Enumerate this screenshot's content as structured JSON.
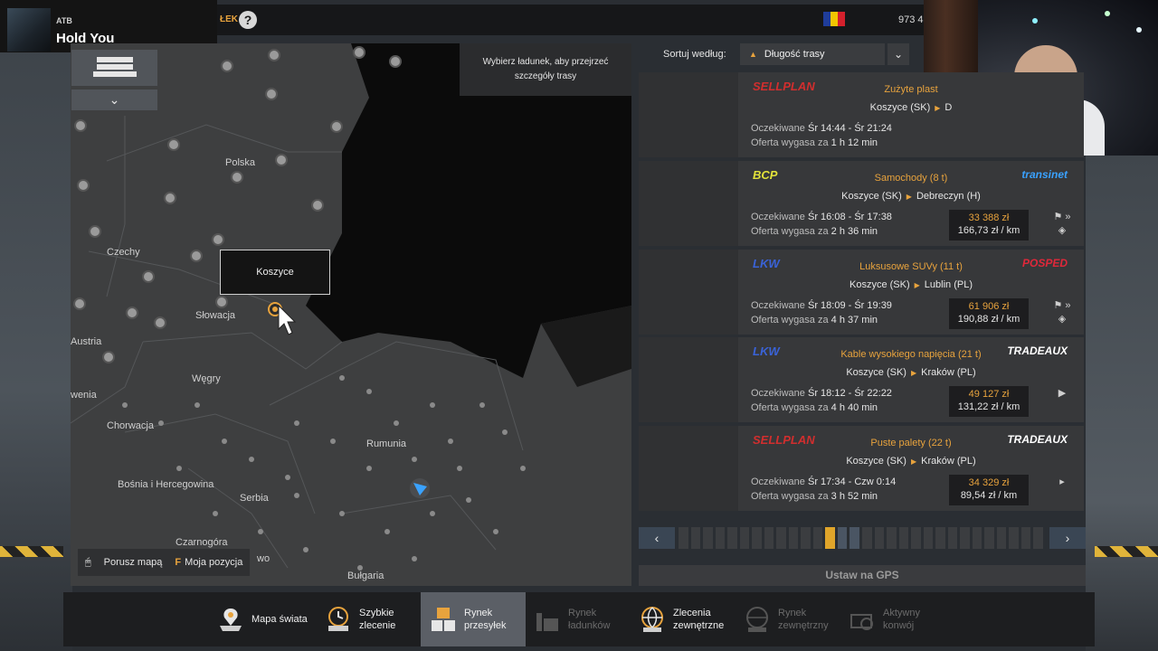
{
  "music": {
    "artist": "ATB",
    "title": "Hold You"
  },
  "header": {
    "title_fragment": "ŁEK",
    "help": "?",
    "money": "973 4"
  },
  "map": {
    "labels": [
      "Polska",
      "Czechy",
      "Słowacja",
      "Austria",
      "Węgry",
      "wenia",
      "Chorwacja",
      "Rumunia",
      "Bośnia i Hercegowina",
      "Serbia",
      "Czarnogóra",
      "wo",
      "Bułgaria"
    ],
    "tooltip": "Koszyce",
    "footer": {
      "move": "Porusz mapą",
      "key": "F",
      "position": "Moja pozycja"
    }
  },
  "hint": {
    "line1": "Wybierz ładunek, aby przejrzeć",
    "line2": "szczegóły trasy"
  },
  "sort": {
    "label": "Sortuj według:",
    "value": "Długość trasy"
  },
  "cards": [
    {
      "company": "SELLPLAN",
      "cargo": "Zużyte plast",
      "from": "Koszyce (SK)",
      "to": "D",
      "expected": "Oczekiwane",
      "window": "Śr 14:44 - Śr 21:24",
      "expire_label": "Oferta wygasa za",
      "expire": "1 h 12 min",
      "receiver": "",
      "price": "",
      "rate": ""
    },
    {
      "company": "BCP",
      "cargo": "Samochody (8 t)",
      "from": "Koszyce (SK)",
      "to": "Debreczyn (H)",
      "expected": "Oczekiwane",
      "window": "Śr 16:08 - Śr 17:38",
      "expire_label": "Oferta wygasa za",
      "expire": "2 h 36 min",
      "receiver": "transinet",
      "price": "33 388 zł",
      "rate": "166,73 zł / km"
    },
    {
      "company": "LKW",
      "cargo": "Luksusowe SUVy (11 t)",
      "from": "Koszyce (SK)",
      "to": "Lublin (PL)",
      "expected": "Oczekiwane",
      "window": "Śr 18:09 - Śr 19:39",
      "expire_label": "Oferta wygasa za",
      "expire": "4 h 37 min",
      "receiver": "POSPED",
      "price": "61 906 zł",
      "rate": "190,88 zł / km"
    },
    {
      "company": "LKW",
      "cargo": "Kable wysokiego napięcia (21 t)",
      "from": "Koszyce (SK)",
      "to": "Kraków (PL)",
      "expected": "Oczekiwane",
      "window": "Śr 18:12 - Śr 22:22",
      "expire_label": "Oferta wygasa za",
      "expire": "4 h 40 min",
      "receiver": "TRADEAUX",
      "price": "49 127 zł",
      "rate": "131,22 zł / km"
    },
    {
      "company": "SELLPLAN",
      "cargo": "Puste palety (22 t)",
      "from": "Koszyce (SK)",
      "to": "Kraków (PL)",
      "expected": "Oczekiwane",
      "window": "Śr 17:34 - Czw 0:14",
      "expire_label": "Oferta wygasa za",
      "expire": "3 h 52 min",
      "receiver": "TRADEAUX",
      "price": "34 329 zł",
      "rate": "89,54 zł / km"
    }
  ],
  "pager": {
    "prev": "‹",
    "next": "›",
    "pages": 30,
    "current": 12
  },
  "gps_button": "Ustaw na GPS",
  "tabs": [
    {
      "line1": "Mapa świata",
      "line2": ""
    },
    {
      "line1": "Szybkie",
      "line2": "zlecenie"
    },
    {
      "line1": "Rynek",
      "line2": "przesyłek"
    },
    {
      "line1": "Rynek",
      "line2": "ładunków"
    },
    {
      "line1": "Zlecenia",
      "line2": "zewnętrzne"
    },
    {
      "line1": "Rynek",
      "line2": "zewnętrzny"
    },
    {
      "line1": "Aktywny",
      "line2": "konwój"
    }
  ]
}
